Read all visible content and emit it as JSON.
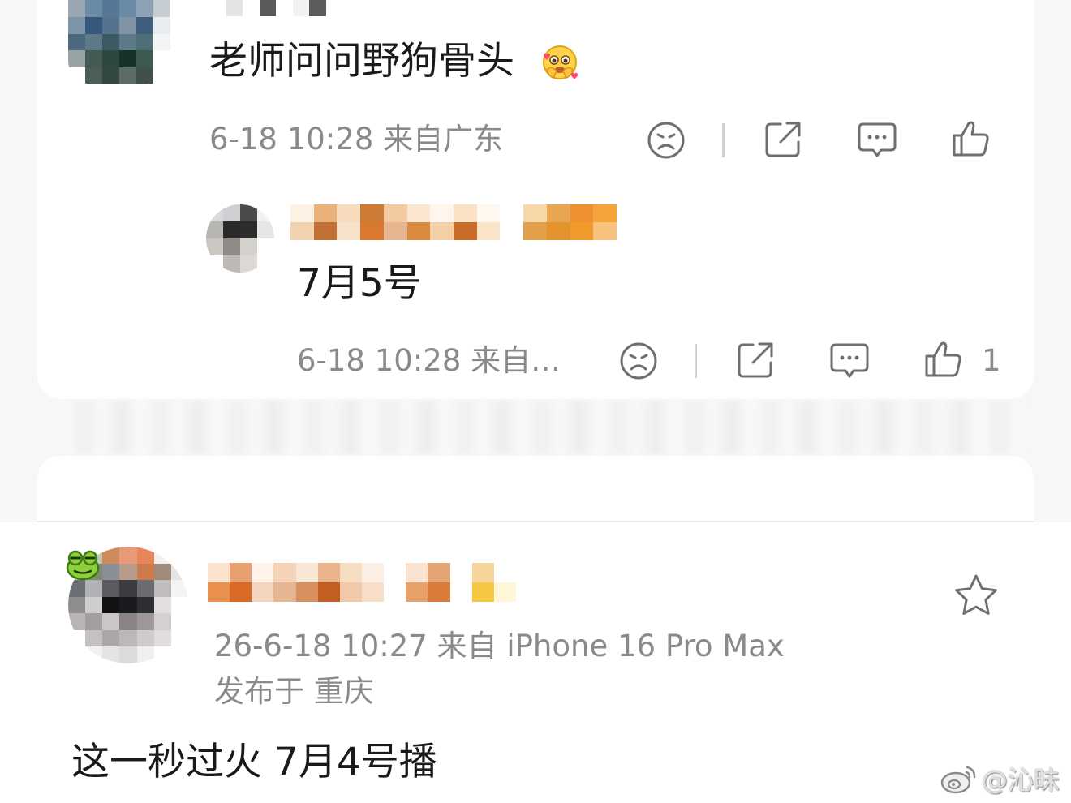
{
  "top_comment": {
    "text": "老师问问野狗骨头",
    "emoji": "crying-pleading-emoji",
    "meta": "6-18 10:28 来自广东",
    "actions": [
      "dislike-icon",
      "share-icon",
      "comment-icon",
      "like-icon"
    ]
  },
  "reply": {
    "text": "7月5号",
    "meta": "6-18 10:28 来自…",
    "like_count": "1",
    "actions": [
      "dislike-icon",
      "share-icon",
      "comment-icon",
      "like-icon"
    ]
  },
  "post": {
    "meta_time": "26-6-18 10:27  来自 iPhone 16 Pro Max",
    "meta_location": "发布于 重庆",
    "text": "这一秒过火 7月4号播",
    "favorite_icon": "star-icon"
  },
  "watermark": {
    "logo": "weibo-icon",
    "text": "@沁昧"
  },
  "colors": {
    "text_primary": "#1a1a1a",
    "text_secondary": "#8a8a8a",
    "icon": "#6f6f6f",
    "background": "#f7f7f7",
    "card": "#ffffff"
  }
}
